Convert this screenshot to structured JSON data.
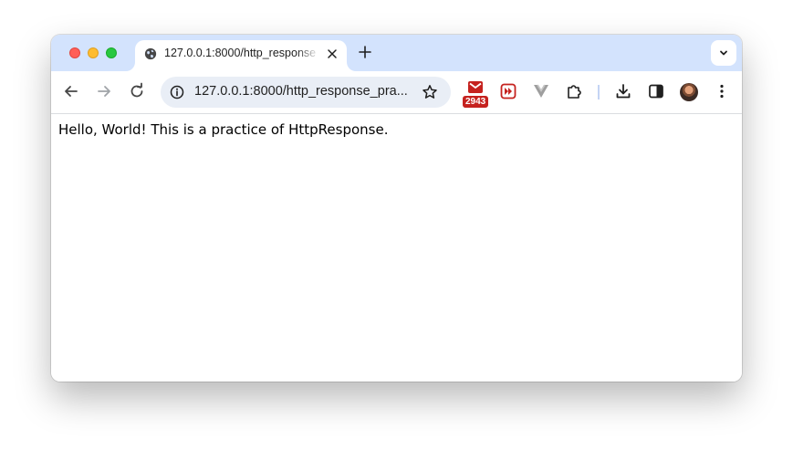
{
  "browser": {
    "tab": {
      "title": "127.0.0.1:8000/http_response",
      "favicon": "globe-icon"
    },
    "address_bar": {
      "url": "127.0.0.1:8000/http_response_pra...",
      "info_icon": "info-icon",
      "bookmark_icon": "star-icon"
    },
    "extensions": [
      {
        "name": "mail-extension-icon",
        "badge": "2943"
      },
      {
        "name": "fast-forward-extension-icon"
      },
      {
        "name": "vue-extension-icon"
      },
      {
        "name": "puzzle-extensions-icon"
      }
    ],
    "toolbar_icons": [
      "back-icon",
      "forward-icon",
      "reload-icon",
      "download-icon",
      "side-panel-icon",
      "avatar",
      "more-icon"
    ]
  },
  "page": {
    "text": "Hello, World! This is a practice of HttpResponse."
  },
  "colors": {
    "tabstrip": "#d3e3fd",
    "omnibox": "#e9eef6",
    "badge": "#c5221f"
  }
}
